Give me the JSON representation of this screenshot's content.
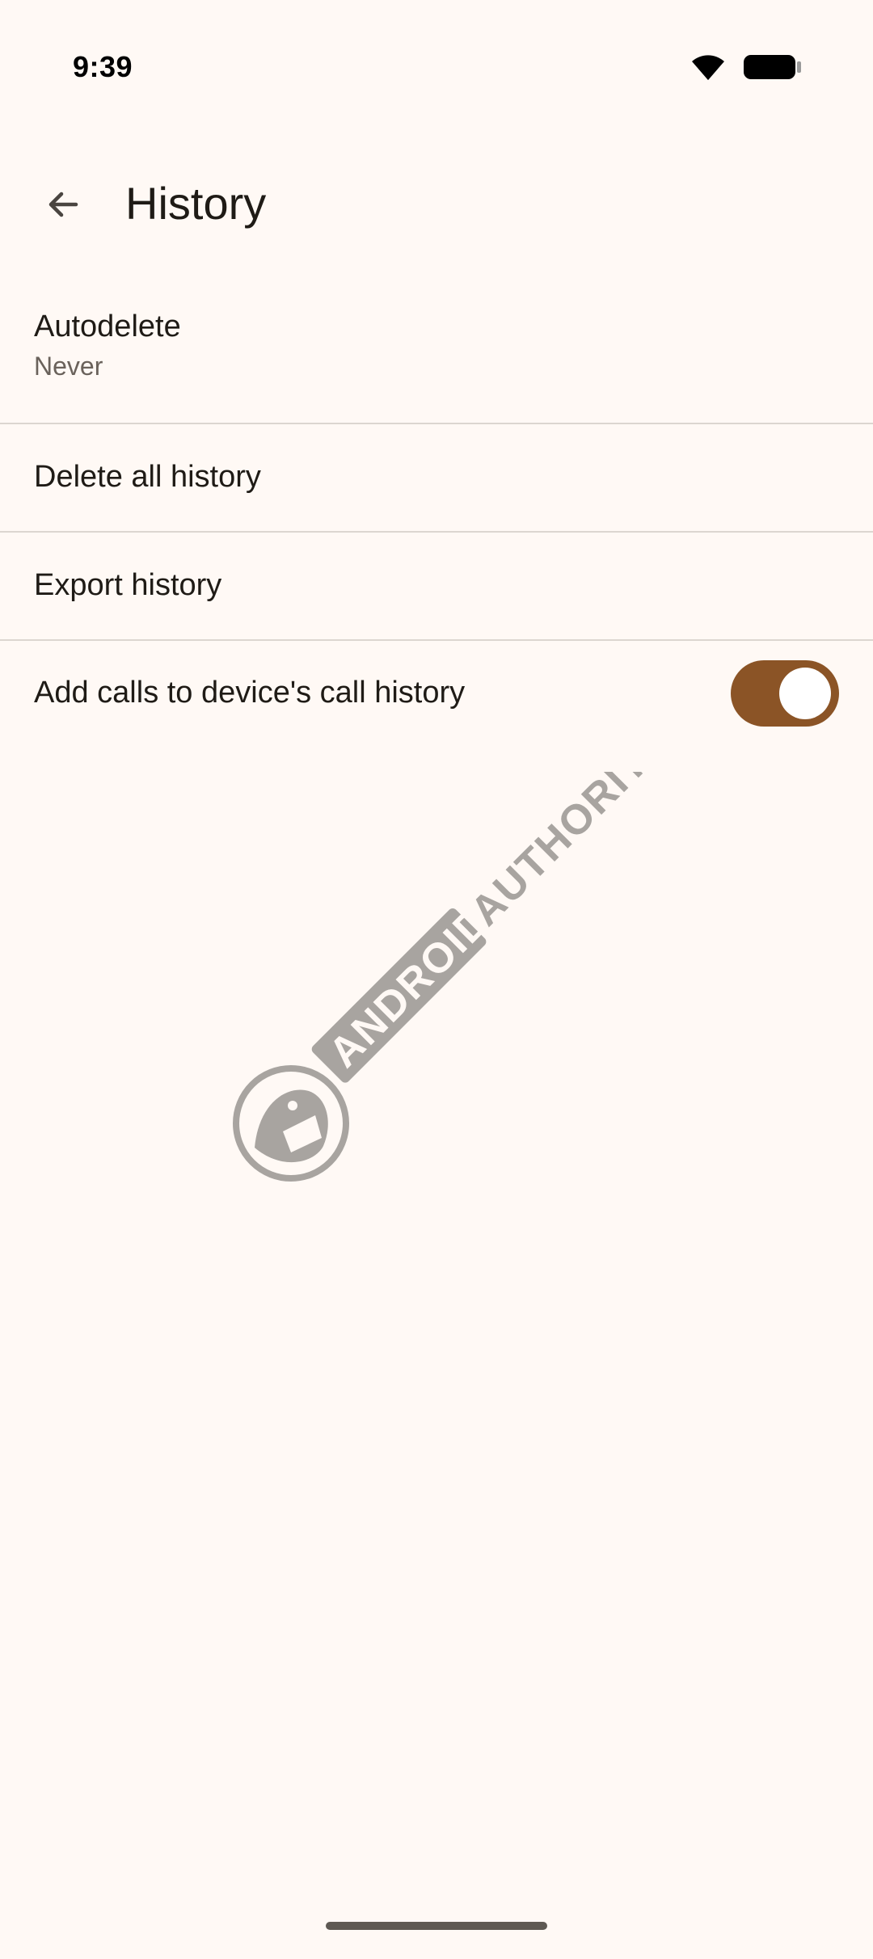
{
  "status_bar": {
    "time": "9:39",
    "icons": [
      "wifi-icon",
      "battery-icon"
    ]
  },
  "app_bar": {
    "back_icon": "arrow-back-icon",
    "title": "History"
  },
  "settings": {
    "items": [
      {
        "title": "Autodelete",
        "subtitle": "Never"
      },
      {
        "title": "Delete all history"
      },
      {
        "title": "Export history"
      },
      {
        "title": "Add calls to device's call history",
        "toggle_on": true
      }
    ]
  },
  "watermark": {
    "text": "ANDROID AUTHORITY"
  },
  "colors": {
    "background": "#FFF9F5",
    "accent": "#8B5426",
    "divider": "#DCD6D0",
    "watermark": "#A8A4A0"
  }
}
